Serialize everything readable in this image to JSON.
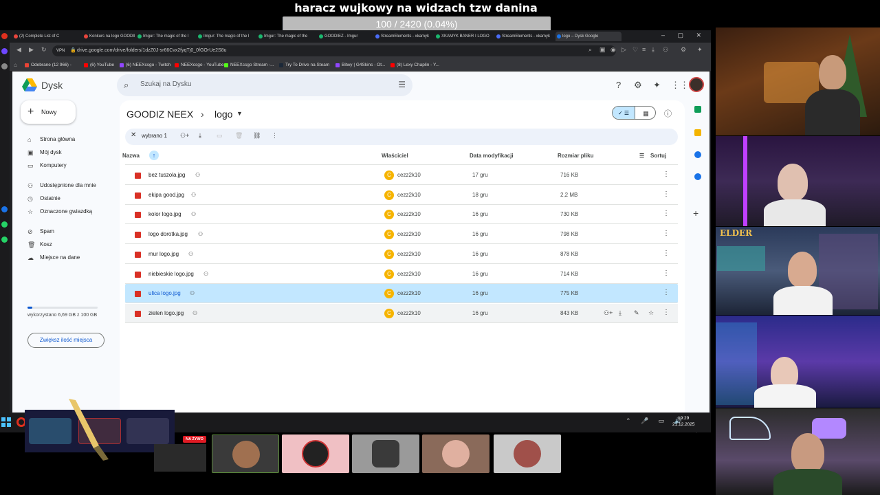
{
  "overlay": {
    "banner_title": "haracz wujkowy na widzach tzw danina",
    "progress_text": "100 / 2420 (0.04%)",
    "progress_fraction": 0.04
  },
  "browser": {
    "tabs": [
      {
        "label": "(2) Complete List of C",
        "color": "#e8453c"
      },
      {
        "label": "Konkurs na logo GOODIE",
        "color": "#e8453c"
      },
      {
        "label": "Imgur: The magic of the I",
        "color": "#1bb76e"
      },
      {
        "label": "Imgur: The magic of the I",
        "color": "#1bb76e"
      },
      {
        "label": "Imgur: The magic of the",
        "color": "#1bb76e"
      },
      {
        "label": "GOODIEZ - Imgur",
        "color": "#1bb76e"
      },
      {
        "label": "StreamElements - xkamyk",
        "color": "#4a6cf7"
      },
      {
        "label": "XKAMYK BANER I LOGO",
        "color": "#1bb76e"
      },
      {
        "label": "StreamElements - xkamyk",
        "color": "#4a6cf7"
      },
      {
        "label": "logo – Dysk Google",
        "color": "#1a73e8"
      }
    ],
    "url": "drive.google.com/drive/folders/1dzZ0J-sr66Cvx2fyqTj0_0fGOrUe2S8u",
    "vpn_label": "VPN",
    "bookmarks": [
      {
        "label": "Odebrane (12 966) -",
        "color": "#ea4335"
      },
      {
        "label": "(6) YouTube",
        "color": "#ff0000"
      },
      {
        "label": "(6) NEEXcsgo - Twitch",
        "color": "#9146ff"
      },
      {
        "label": "NEEXcsgo - YouTube",
        "color": "#ff0000"
      },
      {
        "label": "NEEXcsgo Stream -...",
        "color": "#53fc18"
      },
      {
        "label": "Try To Drive na Steam",
        "color": "#1b2838"
      },
      {
        "label": "Bitwy | G4Skins - Ot...",
        "color": "#9146ff"
      },
      {
        "label": "(8) Lexy Chaplin - Y...",
        "color": "#ff0000"
      }
    ]
  },
  "drive": {
    "app_name": "Dysk",
    "search_placeholder": "Szukaj na Dysku",
    "new_label": "Nowy",
    "nav": [
      {
        "label": "Strona główna",
        "icon": "home-icon"
      },
      {
        "label": "Mój dysk",
        "icon": "my-drive-icon"
      },
      {
        "label": "Komputery",
        "icon": "computer-icon"
      },
      {
        "label": "Udostępnione dla mnie",
        "icon": "shared-icon"
      },
      {
        "label": "Ostatnie",
        "icon": "clock-icon"
      },
      {
        "label": "Oznaczone gwiazdką",
        "icon": "star-icon"
      },
      {
        "label": "Spam",
        "icon": "spam-icon"
      },
      {
        "label": "Kosz",
        "icon": "trash-icon"
      },
      {
        "label": "Miejsce na dane",
        "icon": "cloud-icon"
      }
    ],
    "storage_text": "wykorzystano 6,69 GB z 100 GB",
    "storage_fraction": 0.0669,
    "more_storage_label": "Zwiększ ilość miejsca",
    "breadcrumb_root": "GOODIZ NEEX",
    "breadcrumb_current": "logo",
    "selected_count": "wybrano 1",
    "columns": {
      "name": "Nazwa",
      "owner": "Właściciel",
      "modified": "Data modyfikacji",
      "size": "Rozmiar pliku",
      "sort": "Sortuj"
    },
    "files": [
      {
        "name": "bez tuszola.jpg",
        "owner": "cezz2k10",
        "owner_initial": "C",
        "date": "17 gru",
        "size": "716 KB",
        "state": "normal"
      },
      {
        "name": "ekipa good.jpg",
        "owner": "cezz2k10",
        "owner_initial": "C",
        "date": "18 gru",
        "size": "2,2 MB",
        "state": "normal"
      },
      {
        "name": "kolor logo.jpg",
        "owner": "cezz2k10",
        "owner_initial": "C",
        "date": "16 gru",
        "size": "730 KB",
        "state": "normal"
      },
      {
        "name": "logo dorotka.jpg",
        "owner": "cezz2k10",
        "owner_initial": "C",
        "date": "16 gru",
        "size": "798 KB",
        "state": "normal"
      },
      {
        "name": "mur logo.jpg",
        "owner": "cezz2k10",
        "owner_initial": "C",
        "date": "16 gru",
        "size": "878 KB",
        "state": "normal"
      },
      {
        "name": "niebieskie logo.jpg",
        "owner": "cezz2k10",
        "owner_initial": "C",
        "date": "16 gru",
        "size": "714 KB",
        "state": "normal"
      },
      {
        "name": "ulica logo.jpg",
        "owner": "cezz2k10",
        "owner_initial": "C",
        "date": "16 gru",
        "size": "775 KB",
        "state": "selected"
      },
      {
        "name": "zielen logo.jpg",
        "owner": "cezz2k10",
        "owner_initial": "C",
        "date": "16 gru",
        "size": "843 KB",
        "state": "hover"
      }
    ]
  },
  "taskbar": {
    "time": "19:29",
    "date": "21.12.2025"
  },
  "stream": {
    "live_label": "NA ŻYWO",
    "cam3_badge": "ELDER"
  }
}
